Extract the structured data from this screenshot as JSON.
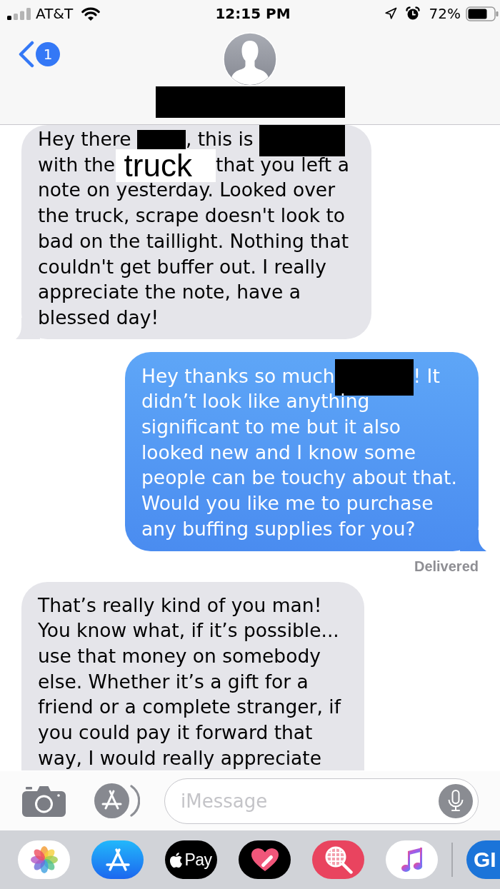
{
  "status_bar": {
    "carrier": "AT&T",
    "time": "12:15 PM",
    "battery": "72%"
  },
  "header": {
    "unread_badge": "1",
    "contact_name": {
      "redacted": true
    }
  },
  "messages": [
    {
      "kind": "received",
      "tail": true,
      "segments": [
        {
          "kind": "text",
          "text": "Hey there "
        },
        {
          "kind": "redacted"
        },
        {
          "kind": "text",
          "text": ", this is "
        },
        {
          "kind": "redacted"
        },
        {
          "kind": "text",
          "text": " with the "
        },
        {
          "kind": "patch",
          "text": "truck"
        },
        {
          "kind": "text",
          "text": " that you left a note on yesterday. Looked over the truck, scrape doesn't look to bad on the taillight. Nothing that couldn't get buffer out. I really appreciate the note, have a blessed day!"
        }
      ]
    },
    {
      "kind": "sent",
      "tail": true,
      "status": "Delivered",
      "segments": [
        {
          "kind": "text",
          "text": "Hey thanks so much"
        },
        {
          "kind": "redacted"
        },
        {
          "kind": "text",
          "text": "! It didn’t look like anything significant to me but it also looked new and I know some people can be touchy about that. Would you like me to purchase any buffing supplies for you?"
        }
      ]
    },
    {
      "kind": "received",
      "tail": false,
      "segments": [
        {
          "kind": "text",
          "text": "That’s really kind of you man! You know what, if it’s possible... use that money on somebody else. Whether it’s a gift for a friend or a complete stranger, if you could pay it forward that way, I would really appreciate"
        }
      ]
    }
  ],
  "composer": {
    "placeholder": "iMessage"
  },
  "app_drawer": [
    {
      "kind": "photos"
    },
    {
      "kind": "app-store"
    },
    {
      "kind": "apple-pay",
      "label": "Pay"
    },
    {
      "kind": "heart"
    },
    {
      "kind": "image-search"
    },
    {
      "kind": "music"
    },
    {
      "kind": "gif",
      "label": "GI"
    }
  ]
}
